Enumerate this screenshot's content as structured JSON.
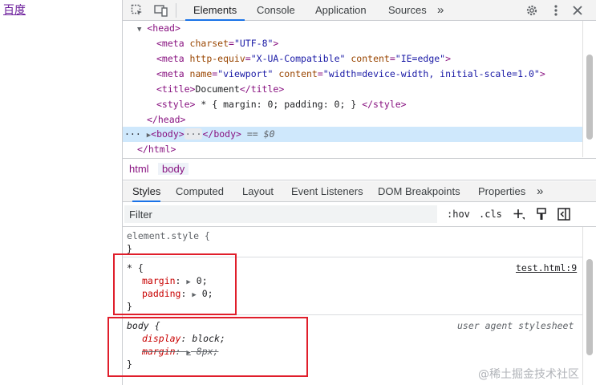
{
  "page": {
    "link_text": "百度"
  },
  "toolbar": {
    "tabs": [
      "Elements",
      "Console",
      "Application",
      "Sources"
    ],
    "more_glyph": "»",
    "icons": [
      "inspect-icon",
      "device-toggle-icon",
      "settings-gear-icon",
      "more-vert-icon",
      "close-icon"
    ]
  },
  "tree": {
    "head_open": "<head>",
    "meta_charset": {
      "tag": "<meta ",
      "attr": "charset",
      "val": "\"UTF-8\"",
      "close": ">"
    },
    "meta_compat": {
      "tag": "<meta ",
      "attr1": "http-equiv",
      "val1": "\"X-UA-Compatible\"",
      "attr2": "content",
      "val2": "\"IE=edge\"",
      "close": ">"
    },
    "meta_viewport": {
      "tag": "<meta ",
      "attr1": "name",
      "val1": "\"viewport\"",
      "attr2": "content",
      "val2": "\"width=device-width, initial-scale=1.0\"",
      "close": ">"
    },
    "title": {
      "open": "<title>",
      "text": "Document",
      "close": "</title>"
    },
    "style": {
      "open": "<style>",
      "text": " * { margin: 0; padding: 0; } ",
      "close": "</style>"
    },
    "head_close": "</head>",
    "body": {
      "dots": "···",
      "open": "<body>",
      "ellipsis": "···",
      "close": "</body>",
      "eq": " == ",
      "dollar": "$0"
    },
    "html_close": "</html>"
  },
  "breadcrumbs": [
    "html",
    "body"
  ],
  "subtabs": [
    "Styles",
    "Computed",
    "Layout",
    "Event Listeners",
    "DOM Breakpoints",
    "Properties"
  ],
  "filter": {
    "placeholder": "Filter",
    "hov": ":hov",
    "cls": ".cls"
  },
  "rules": {
    "element_style": {
      "selector": "element.style {",
      "close": "}"
    },
    "universal": {
      "selector": "* {",
      "source": "test.html:9",
      "props": [
        {
          "name": "margin",
          "value": "0;"
        },
        {
          "name": "padding",
          "value": "0;"
        }
      ],
      "close": "}"
    },
    "body": {
      "selector": "body {",
      "source": "user agent stylesheet",
      "props": [
        {
          "name": "display",
          "value": "block;"
        },
        {
          "name": "margin",
          "value": "8px;"
        }
      ],
      "close": "}"
    }
  },
  "watermark": "@稀土掘金技术社区"
}
